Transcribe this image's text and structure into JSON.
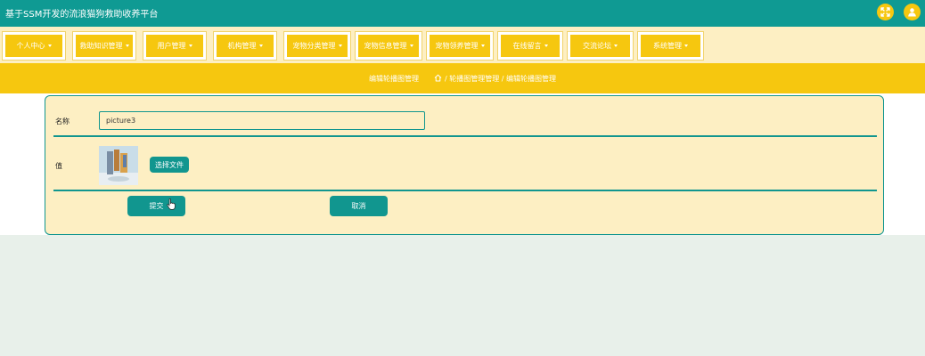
{
  "header": {
    "app_title": "基于SSM开发的流浪猫狗救助收养平台",
    "icons": [
      "fullscreen-icon",
      "user-icon"
    ],
    "colors": {
      "header_bg": "#0f9a93",
      "accent_yellow": "#f6c70f"
    }
  },
  "nav": {
    "items": [
      {
        "label": "个人中心"
      },
      {
        "label": "救助知识管理"
      },
      {
        "label": "用户管理"
      },
      {
        "label": "机构管理"
      },
      {
        "label": "宠物分类管理"
      },
      {
        "label": "宠物信息管理"
      },
      {
        "label": "宠物领养管理"
      },
      {
        "label": "在线留言"
      },
      {
        "label": "交流论坛"
      },
      {
        "label": "系统管理"
      }
    ]
  },
  "breadcrumb": {
    "page_title": "编辑轮播图管理",
    "path": "/ 轮播图管理管理 / 编辑轮播图管理",
    "home_icon": "home-icon"
  },
  "form": {
    "name_label": "名称",
    "name_value": "picture3",
    "value_label": "值",
    "choose_file_label": "选择文件",
    "submit_label": "提交",
    "cancel_label": "取消"
  }
}
